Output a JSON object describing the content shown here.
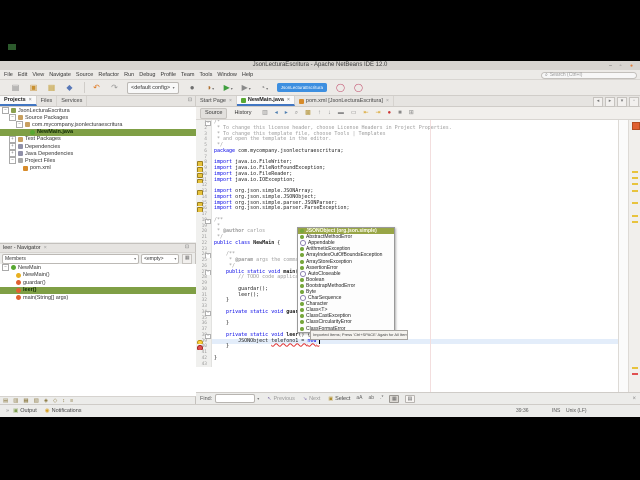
{
  "window": {
    "title": "JsonLecturaEscritura - Apache NetBeans IDE 12.0",
    "buttons": [
      "–",
      "▫",
      "●"
    ]
  },
  "menubar": {
    "items": [
      "File",
      "Edit",
      "View",
      "Navigate",
      "Source",
      "Refactor",
      "Run",
      "Debug",
      "Profile",
      "Team",
      "Tools",
      "Window",
      "Help"
    ],
    "search_placeholder": "Search (Ctrl+I)"
  },
  "toolbar": {
    "items": [
      {
        "type": "icon",
        "name": "new-file-icon",
        "glyph": "▤",
        "color": "#8a8a8a"
      },
      {
        "type": "icon",
        "name": "new-project-icon",
        "glyph": "▣",
        "color": "#c89030"
      },
      {
        "type": "icon",
        "name": "open-project-icon",
        "glyph": "▦",
        "color": "#c8a84e"
      },
      {
        "type": "icon",
        "name": "save-all-icon",
        "glyph": "◆",
        "color": "#5878b8"
      },
      {
        "type": "sep"
      },
      {
        "type": "icon",
        "name": "undo-icon",
        "glyph": "↶",
        "color": "#e07820"
      },
      {
        "type": "icon",
        "name": "redo-icon",
        "glyph": "↷",
        "color": "#989898"
      },
      {
        "type": "combo",
        "name": "config-select",
        "value": "<default config>"
      },
      {
        "type": "icon",
        "name": "build-project-icon",
        "glyph": "●",
        "color": "#6f6f6f"
      },
      {
        "type": "icon",
        "name": "clean-build-project-icon",
        "glyph": "◑",
        "color": "#b07030",
        "drop": true
      },
      {
        "type": "icon",
        "name": "run-project-icon",
        "glyph": "▶",
        "color": "#3f9f3f",
        "drop": true
      },
      {
        "type": "icon",
        "name": "debug-project-icon",
        "glyph": "▶",
        "color": "#8a8a8a",
        "drop": true
      },
      {
        "type": "icon",
        "name": "profile-project-icon",
        "glyph": "◔",
        "color": "#8a8a8a",
        "drop": true
      },
      {
        "type": "progress",
        "name": "progress-indicator",
        "label": "JsonLecturaEscritura"
      },
      {
        "type": "icon",
        "name": "status-circle-icon-1",
        "glyph": "◯",
        "color": "#c04868"
      },
      {
        "type": "icon",
        "name": "status-circle-icon-2",
        "glyph": "◯",
        "color": "#c04868"
      }
    ]
  },
  "left_tabs": [
    {
      "label": "Projects",
      "active": true,
      "close": true
    },
    {
      "label": "Files"
    },
    {
      "label": "Services"
    }
  ],
  "projects_tree": [
    {
      "label": "JsonLecturaEscritura",
      "icon": "maven-project-icon",
      "shape": "sq",
      "color": "#8aa04f",
      "depth": 0,
      "expand": "-"
    },
    {
      "label": "Source Packages",
      "icon": "source-packages-icon",
      "shape": "sq",
      "color": "#c8a060",
      "depth": 1,
      "expand": "-"
    },
    {
      "label": "com.mycompany.jsonlecturaescritura",
      "icon": "package-icon",
      "shape": "sq",
      "color": "#c8a060",
      "depth": 2,
      "expand": "-"
    },
    {
      "label": "NewMain.java",
      "icon": "java-class-icon",
      "shape": "ci",
      "color": "#58a832",
      "depth": 3,
      "selected": true
    },
    {
      "label": "Test Packages",
      "icon": "test-packages-icon",
      "shape": "sq",
      "color": "#c8a060",
      "depth": 1,
      "expand": "+"
    },
    {
      "label": "Dependencies",
      "icon": "dependencies-icon",
      "shape": "sq",
      "color": "#9090a8",
      "depth": 1,
      "expand": "+"
    },
    {
      "label": "Java Dependencies",
      "icon": "java-dependencies-icon",
      "shape": "sq",
      "color": "#9090a8",
      "depth": 1,
      "expand": "+"
    },
    {
      "label": "Project Files",
      "icon": "project-files-icon",
      "shape": "sq",
      "color": "#a8a8a8",
      "depth": 1,
      "expand": "-"
    },
    {
      "label": "pom.xml",
      "icon": "xml-file-icon",
      "shape": "sq",
      "color": "#d78b2a",
      "depth": 2
    }
  ],
  "navigator": {
    "title": "leer - Navigator",
    "members_combo": "Members",
    "filter_combo": "<empty>",
    "tree": [
      {
        "label": "NewMain",
        "icon": "class-icon",
        "shape": "ci",
        "color": "#58a832",
        "depth": 0,
        "expand": "-"
      },
      {
        "label": "NewMain()",
        "icon": "constructor-icon",
        "shape": "ci",
        "color": "#e8b020",
        "depth": 1
      },
      {
        "label": "guardar()",
        "icon": "method-icon",
        "shape": "ci",
        "color": "#e06030",
        "depth": 1
      },
      {
        "label": "leer()",
        "icon": "method-icon",
        "shape": "ci",
        "color": "#e06030",
        "depth": 1,
        "selected": true
      },
      {
        "label": "main(String[] args)",
        "icon": "static-method-icon",
        "shape": "ci",
        "color": "#e06030",
        "depth": 1
      }
    ],
    "filter_icons": [
      "show-inherited-icon",
      "show-fields-icon",
      "show-constructors-icon",
      "show-methods-icon",
      "show-static-icon",
      "show-non-public-icon",
      "sort-alpha-icon",
      "sort-source-icon"
    ]
  },
  "editor": {
    "tabs": [
      {
        "label": "Start Page",
        "close": true
      },
      {
        "label": "NewMain.java",
        "active": true,
        "close": true,
        "icon": "java-class-icon",
        "icon_color": "#58a832",
        "icon_shape": "ci"
      },
      {
        "label": "pom.xml [JsonLecturaEscritura]",
        "close": true,
        "icon": "xml-file-icon",
        "icon_color": "#d78b2a",
        "icon_shape": "sq"
      }
    ],
    "tabstrip_buttons": [
      "◂",
      "▸",
      "▾",
      "▫"
    ],
    "toolbar": {
      "source_label": "Source",
      "history_label": "History",
      "icons": [
        {
          "name": "diff-icon",
          "glyph": "▥",
          "color": "#8a8a8a"
        },
        {
          "name": "back-icon",
          "glyph": "◂",
          "color": "#4f7fb0"
        },
        {
          "name": "forward-icon",
          "glyph": "▸",
          "color": "#4f7fb0"
        },
        {
          "name": "find-selection-icon",
          "glyph": "⌕",
          "color": "#8a8a8a"
        },
        {
          "name": "highlight-occurrences-icon",
          "glyph": "▩",
          "color": "#b09030"
        },
        {
          "name": "previous-occurrence-icon",
          "glyph": "↑",
          "color": "#8a8a8a"
        },
        {
          "name": "next-occurrence-icon",
          "glyph": "↓",
          "color": "#8a8a8a"
        },
        {
          "name": "comment-icon",
          "glyph": "▬",
          "color": "#8a8a8a"
        },
        {
          "name": "uncomment-icon",
          "glyph": "▭",
          "color": "#8a8a8a"
        },
        {
          "name": "previous-bookmark-icon",
          "glyph": "⇤",
          "color": "#d8a020"
        },
        {
          "name": "next-bookmark-icon",
          "glyph": "⇥",
          "color": "#d8a020"
        },
        {
          "name": "record-macro-icon",
          "glyph": "●",
          "color": "#cc3333"
        },
        {
          "name": "run-macro-icon",
          "glyph": "■",
          "color": "#8a8a8a"
        },
        {
          "name": "insert-icon",
          "glyph": "⊞",
          "color": "#8a8a8a"
        }
      ]
    },
    "lines": [
      {
        "n": 1,
        "parts": [
          [
            "/*",
            "c"
          ]
        ]
      },
      {
        "n": 2,
        "parts": [
          [
            " * To change this license header, choose License Headers in Project Properties.",
            "c"
          ]
        ]
      },
      {
        "n": 3,
        "parts": [
          [
            " * To change this template file, choose Tools | Templates",
            "c"
          ]
        ]
      },
      {
        "n": 4,
        "parts": [
          [
            " * and open the template in the editor.",
            "c"
          ]
        ]
      },
      {
        "n": 5,
        "parts": [
          [
            " */",
            "c"
          ]
        ]
      },
      {
        "n": 6,
        "parts": [
          [
            "package ",
            "k"
          ],
          [
            "com.mycompany.jsonlecturaescritura;",
            "p"
          ]
        ]
      },
      {
        "n": 7,
        "parts": []
      },
      {
        "n": 8,
        "parts": [
          [
            "import ",
            "k"
          ],
          [
            "java.io.FileWriter;",
            "p"
          ]
        ]
      },
      {
        "n": 9,
        "parts": [
          [
            "import ",
            "k"
          ],
          [
            "java.io.FileNotFoundException;",
            "p"
          ]
        ]
      },
      {
        "n": 10,
        "parts": [
          [
            "import ",
            "k"
          ],
          [
            "java.io.FileReader;",
            "p"
          ]
        ]
      },
      {
        "n": 11,
        "parts": [
          [
            "import ",
            "k"
          ],
          [
            "java.io.IOException;",
            "p"
          ]
        ]
      },
      {
        "n": 12,
        "parts": []
      },
      {
        "n": 13,
        "parts": [
          [
            "import ",
            "k"
          ],
          [
            "org.json.simple.JSONArray;",
            "p"
          ]
        ]
      },
      {
        "n": 14,
        "parts": [
          [
            "import ",
            "k"
          ],
          [
            "org.json.simple.JSONObject;",
            "p"
          ]
        ]
      },
      {
        "n": 15,
        "parts": [
          [
            "import ",
            "k"
          ],
          [
            "org.json.simple.parser.JSONParser;",
            "p"
          ]
        ]
      },
      {
        "n": 16,
        "parts": [
          [
            "import ",
            "k"
          ],
          [
            "org.json.simple.parser.ParseException;",
            "p"
          ]
        ]
      },
      {
        "n": 17,
        "parts": []
      },
      {
        "n": 18,
        "parts": [
          [
            "/**",
            "c"
          ]
        ]
      },
      {
        "n": 19,
        "parts": [
          [
            " *",
            "c"
          ]
        ]
      },
      {
        "n": 20,
        "parts": [
          [
            " * ",
            "c"
          ],
          [
            "@author",
            "cb"
          ],
          [
            " carlos",
            "c"
          ]
        ]
      },
      {
        "n": 21,
        "parts": [
          [
            " */",
            "c"
          ]
        ]
      },
      {
        "n": 22,
        "parts": [
          [
            "public class ",
            "k"
          ],
          [
            "NewMain",
            "b"
          ],
          [
            " {",
            "p"
          ]
        ]
      },
      {
        "n": 23,
        "parts": []
      },
      {
        "n": 24,
        "parts": [
          [
            "    /**",
            "c"
          ]
        ]
      },
      {
        "n": 25,
        "parts": [
          [
            "     * ",
            "c"
          ],
          [
            "@param",
            "cb"
          ],
          [
            " args the command line arguments",
            "c"
          ]
        ]
      },
      {
        "n": 26,
        "parts": [
          [
            "     */",
            "c"
          ]
        ]
      },
      {
        "n": 27,
        "parts": [
          [
            "    ",
            "p"
          ],
          [
            "public static void ",
            "k"
          ],
          [
            "main",
            "b"
          ],
          [
            "(String[] args) {",
            "p"
          ]
        ]
      },
      {
        "n": 28,
        "parts": [
          [
            "        // TODO code application logic here",
            "c"
          ]
        ]
      },
      {
        "n": 29,
        "parts": []
      },
      {
        "n": 30,
        "parts": [
          [
            "        guardar();",
            "p"
          ]
        ]
      },
      {
        "n": 31,
        "parts": [
          [
            "        leer();",
            "p"
          ]
        ]
      },
      {
        "n": 32,
        "parts": [
          [
            "    }",
            "p"
          ]
        ]
      },
      {
        "n": 33,
        "parts": []
      },
      {
        "n": 34,
        "parts": [
          [
            "    ",
            "p"
          ],
          [
            "private static void ",
            "k"
          ],
          [
            "guardar",
            "b"
          ],
          [
            "() {",
            "p"
          ]
        ]
      },
      {
        "n": 35,
        "parts": []
      },
      {
        "n": 36,
        "parts": [
          [
            "    }",
            "p"
          ]
        ]
      },
      {
        "n": 37,
        "parts": []
      },
      {
        "n": 38,
        "parts": [
          [
            "    ",
            "p"
          ],
          [
            "private static void ",
            "k"
          ],
          [
            "leer",
            "b"
          ],
          [
            "() {",
            "p"
          ]
        ]
      },
      {
        "n": 39,
        "parts": [
          [
            "        JSONObject ",
            "p"
          ],
          [
            "telefono1 = ",
            "e"
          ],
          [
            "new",
            "ke"
          ],
          [
            " ",
            "e"
          ]
        ]
      },
      {
        "n": 40,
        "parts": [
          [
            "    }",
            "p"
          ]
        ]
      },
      {
        "n": 41,
        "parts": []
      },
      {
        "n": 42,
        "parts": [
          [
            "}",
            "p"
          ]
        ]
      },
      {
        "n": 43,
        "parts": []
      }
    ],
    "current_line": 39,
    "warn_lines": [
      8,
      9,
      10,
      11,
      13,
      15,
      16
    ],
    "bulb_line": 39,
    "error_line": 40,
    "fold_lines": [
      1,
      18,
      24,
      27,
      34,
      38
    ],
    "completion": {
      "items": [
        {
          "label": "JSONObject (org.json.simple)",
          "kind": "class",
          "selected": true
        },
        {
          "label": "AbstractMethodError",
          "kind": "class"
        },
        {
          "label": "Appendable",
          "kind": "interface"
        },
        {
          "label": "ArithmeticException",
          "kind": "class"
        },
        {
          "label": "ArrayIndexOutOfBoundsException",
          "kind": "class"
        },
        {
          "label": "ArrayStoreException",
          "kind": "class"
        },
        {
          "label": "AssertionError",
          "kind": "class"
        },
        {
          "label": "AutoCloseable",
          "kind": "interface"
        },
        {
          "label": "Boolean",
          "kind": "class"
        },
        {
          "label": "BootstrapMethodError",
          "kind": "class"
        },
        {
          "label": "Byte",
          "kind": "class"
        },
        {
          "label": "CharSequence",
          "kind": "interface"
        },
        {
          "label": "Character",
          "kind": "class"
        },
        {
          "label": "Class<T>",
          "kind": "class"
        },
        {
          "label": "ClassCastException",
          "kind": "class"
        },
        {
          "label": "ClassCircularityError",
          "kind": "class"
        },
        {
          "label": "ClassFormatError",
          "kind": "class"
        }
      ],
      "footer": "Imported Items; Press 'Ctrl+SPACE' Again for All Items"
    },
    "findbar": {
      "label": "Find:",
      "previous": "Previous",
      "next": "Next",
      "select": "Select",
      "toggles": [
        {
          "name": "match-case-icon",
          "glyph": "aA"
        },
        {
          "name": "whole-words-icon",
          "glyph": "ab"
        },
        {
          "name": "regex-icon",
          "glyph": ".*"
        },
        {
          "name": "highlight-results-icon",
          "glyph": "▦",
          "boxed": true,
          "active": true
        },
        {
          "name": "search-selection-icon",
          "glyph": "▤",
          "boxed": true
        }
      ]
    }
  },
  "statusbar": {
    "output_label": "Output",
    "notifications_label": "Notifications",
    "caret": "39:36",
    "mode": "INS",
    "eol": "Unix (LF)"
  },
  "colors": {
    "selection_green": "#7f9f45",
    "completion_selection": "#98a546",
    "progress_blue": "#3d8fe0",
    "keyword_blue": "#0000e6",
    "comment_gray": "#9c9c9c",
    "error_red": "#e03030",
    "warning_yellow": "#e8c33c"
  }
}
